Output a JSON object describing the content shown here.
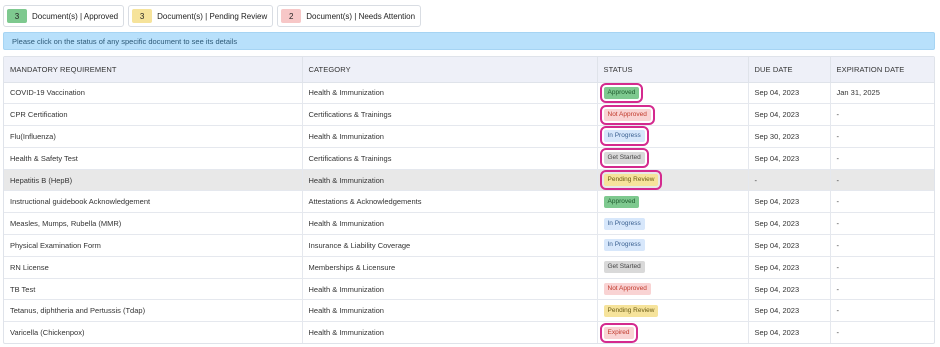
{
  "summary": [
    {
      "count": "3",
      "label": "Document(s) | Approved",
      "color": "#7ec98f"
    },
    {
      "count": "3",
      "label": "Document(s) | Pending Review",
      "color": "#f6e39b"
    },
    {
      "count": "2",
      "label": "Document(s) | Needs Attention",
      "color": "#f7c7c7"
    }
  ],
  "info_text": "Please click on the status of any specific document to see its details",
  "columns": [
    "MANDATORY REQUIREMENT",
    "CATEGORY",
    "STATUS",
    "DUE DATE",
    "EXPIRATION DATE"
  ],
  "status_styles": {
    "Approved": {
      "bg": "#7ec98f",
      "fg": "#1f5a2e"
    },
    "Not Approved": {
      "bg": "#f9d3d3",
      "fg": "#c0392b"
    },
    "In Progress": {
      "bg": "#d7e7fb",
      "fg": "#3a5f8f"
    },
    "Get Started": {
      "bg": "#d9d9d9",
      "fg": "#444444"
    },
    "Pending Review": {
      "bg": "#f6e39b",
      "fg": "#6b5b14"
    },
    "Expired": {
      "bg": "#f9d3d3",
      "fg": "#c0392b"
    }
  },
  "highlight_color": "#d42a8e",
  "rows": [
    {
      "requirement": "COVID-19 Vaccination",
      "category": "Health & Immunization",
      "status": "Approved",
      "due": "Sep 04, 2023",
      "expiration": "Jan 31, 2025",
      "outlined": true,
      "highlighted": false
    },
    {
      "requirement": "CPR Certification",
      "category": "Certifications & Trainings",
      "status": "Not Approved",
      "due": "Sep 04, 2023",
      "expiration": "-",
      "outlined": true,
      "highlighted": false
    },
    {
      "requirement": "Flu(Influenza)",
      "category": "Health & Immunization",
      "status": "In Progress",
      "due": "Sep 30, 2023",
      "expiration": "-",
      "outlined": true,
      "highlighted": false
    },
    {
      "requirement": "Health & Safety Test",
      "category": "Certifications & Trainings",
      "status": "Get Started",
      "due": "Sep 04, 2023",
      "expiration": "-",
      "outlined": true,
      "highlighted": false
    },
    {
      "requirement": "Hepatitis B (HepB)",
      "category": "Health & Immunization",
      "status": "Pending Review",
      "due": "-",
      "expiration": "-",
      "outlined": true,
      "highlighted": true
    },
    {
      "requirement": "Instructional guidebook Acknowledgement",
      "category": "Attestations & Acknowledgements",
      "status": "Approved",
      "due": "Sep 04, 2023",
      "expiration": "-",
      "outlined": false,
      "highlighted": false
    },
    {
      "requirement": "Measles, Mumps, Rubella (MMR)",
      "category": "Health & Immunization",
      "status": "In Progress",
      "due": "Sep 04, 2023",
      "expiration": "-",
      "outlined": false,
      "highlighted": false
    },
    {
      "requirement": "Physical Examination Form",
      "category": "Insurance & Liability Coverage",
      "status": "In Progress",
      "due": "Sep 04, 2023",
      "expiration": "-",
      "outlined": false,
      "highlighted": false
    },
    {
      "requirement": "RN License",
      "category": "Memberships & Licensure",
      "status": "Get Started",
      "due": "Sep 04, 2023",
      "expiration": "-",
      "outlined": false,
      "highlighted": false
    },
    {
      "requirement": "TB Test",
      "category": "Health & Immunization",
      "status": "Not Approved",
      "due": "Sep 04, 2023",
      "expiration": "-",
      "outlined": false,
      "highlighted": false
    },
    {
      "requirement": "Tetanus, diphtheria and Pertussis (Tdap)",
      "category": "Health & Immunization",
      "status": "Pending Review",
      "due": "Sep 04, 2023",
      "expiration": "-",
      "outlined": false,
      "highlighted": false
    },
    {
      "requirement": "Varicella (Chickenpox)",
      "category": "Health & Immunization",
      "status": "Expired",
      "due": "Sep 04, 2023",
      "expiration": "-",
      "outlined": true,
      "highlighted": false
    }
  ]
}
